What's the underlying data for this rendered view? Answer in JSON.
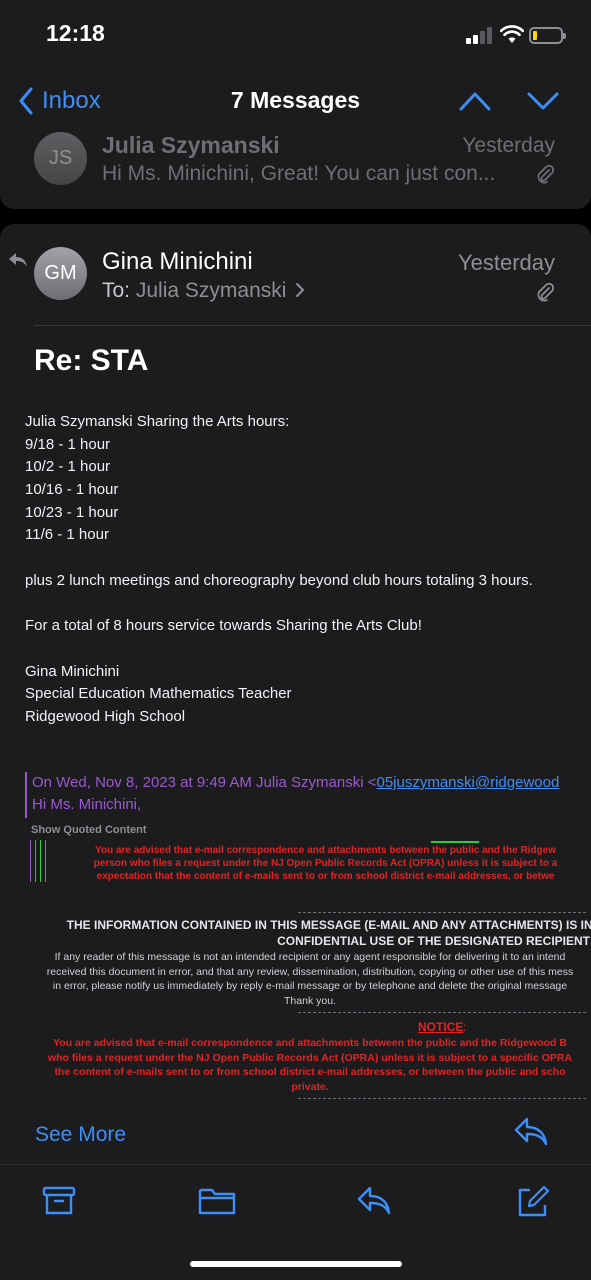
{
  "status_bar": {
    "time": "12:18",
    "battery_color": "#ffd60a"
  },
  "nav": {
    "back_label": "Inbox",
    "title": "7 Messages",
    "accent_color": "#3d8ef7",
    "icons": [
      "chevron-left-icon",
      "chevron-up-icon",
      "chevron-down-icon"
    ]
  },
  "collapsed_message": {
    "initials": "JS",
    "sender": "Julia Szymanski",
    "date": "Yesterday",
    "preview": "Hi Ms. Minichini, Great! You can just con...",
    "attachment_icon": "paperclip-icon"
  },
  "message": {
    "initials": "GM",
    "sender": "Gina Minichini",
    "date": "Yesterday",
    "to_label": "To:",
    "to_name": "Julia Szymanski",
    "subject": "Re: STA",
    "body": {
      "intro": "Julia Szymanski Sharing the Arts hours:",
      "hours": [
        "9/18 - 1 hour",
        "10/2 - 1 hour",
        "10/16 - 1 hour",
        "10/23 - 1 hour",
        "11/6 - 1 hour"
      ],
      "plus": "plus 2 lunch meetings and choreography beyond club hours totaling 3 hours.",
      "total": "For a total of 8 hours service towards Sharing the Arts Club!",
      "signature": [
        "Gina Minichini",
        "Special Education Mathematics Teacher",
        "Ridgewood High School"
      ]
    },
    "quote": {
      "header_prefix": "On Wed, Nov 8, 2023 at 9:49 AM Julia Szymanski <",
      "header_email": "05juszymanski@ridgewood",
      "greeting": "Hi Ms. Minichini,",
      "show_quoted": "Show Quoted Content",
      "quote_color": "#9b59d0"
    },
    "disclaimer": {
      "red_lines": [
        "You are advised that e-mail correspondence and attachments between the public and the Ridgew",
        "person who files a request under the NJ Open Public Records Act (OPRA) unless it is subject to a",
        "expectation that the content of e-mails sent to or from school district e-mail addresses, or betwe"
      ],
      "info_heading": [
        "THE INFORMATION CONTAINED IN THIS MESSAGE (E-MAIL AND ANY ATTACHMENTS) IS INT",
        "CONFIDENTIAL USE OF THE DESIGNATED RECIPIENT"
      ],
      "info_lines": [
        "If any reader of this message is not an intended recipient or any agent responsible for delivering it to an intend",
        "received this document in error, and that any review, dissemination, distribution, copying or other use of this mess",
        "in error, please notify us immediately by reply e-mail message or by telephone and delete the original message",
        "Thank you."
      ],
      "notice_label": "NOTICE",
      "notice_colon": ":",
      "notice_lines": [
        "You are advised that e-mail correspondence and attachments between the public and the Ridgewood B",
        "who files a request under the NJ Open Public Records Act (OPRA) unless it is subject to a specific OPRA",
        "the content of e-mails sent to or from school district e-mail addresses, or between the public and scho",
        "private."
      ],
      "alert_color": "#e02424"
    },
    "see_more": "See More"
  },
  "toolbar": {
    "icons": [
      "archive-icon",
      "folder-icon",
      "reply-icon",
      "compose-icon"
    ]
  }
}
